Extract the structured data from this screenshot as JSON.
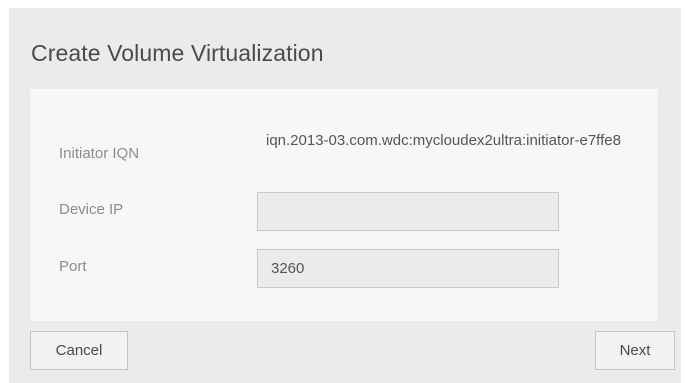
{
  "dialog": {
    "title": "Create Volume Virtualization"
  },
  "form": {
    "initiator_iqn": {
      "label": "Initiator IQN",
      "value": "iqn.2013-03.com.wdc:mycloudex2ultra:initiator-e7ffe8"
    },
    "device_ip": {
      "label": "Device IP",
      "value": ""
    },
    "port": {
      "label": "Port",
      "value": "3260"
    }
  },
  "buttons": {
    "cancel": "Cancel",
    "next": "Next"
  }
}
